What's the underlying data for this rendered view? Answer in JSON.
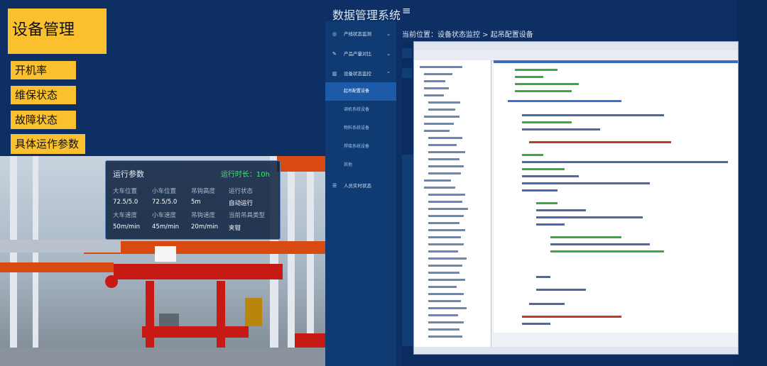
{
  "left": {
    "title": "设备管理",
    "menu": [
      "开机率",
      "维保状态",
      "故障状态",
      "具体运作参数"
    ],
    "params": {
      "title": "运行参数",
      "runtime": "运行时长：10h",
      "labels_row1": [
        "大车位置",
        "小车位置",
        "吊钩高度",
        "运行状态"
      ],
      "values_row1": [
        "72.5/5.0",
        "72.5/5.0",
        "5m",
        "自动运行"
      ],
      "labels_row2": [
        "大车速度",
        "小车速度",
        "吊钩速度",
        "当前吊具类型"
      ],
      "values_row2": [
        "50m/min",
        "45m/min",
        "20m/min",
        "夹钳"
      ]
    },
    "colors": {
      "tag_bg": "#fbc02d",
      "panel_bg": "#0d2f63",
      "runtime_green": "#4ade80"
    }
  },
  "right": {
    "system_title": "数据管理系统",
    "breadcrumb": "当前位置：设备状态监控 > 起吊配置设备",
    "sidebar": [
      {
        "icon": "target-icon",
        "label": "产线状态监测",
        "has_chevron": true
      },
      {
        "icon": "pen-icon",
        "label": "产品产量对比",
        "has_chevron": true
      },
      {
        "icon": "bar-chart-icon",
        "label": "设备状态监控",
        "has_chevron": true,
        "expanded": true
      }
    ],
    "submenu": [
      "起吊配置设备",
      "调机系统设备",
      "物料系统设备",
      "焊接系统设备",
      "其他"
    ],
    "sidebar_last": {
      "icon": "list-icon",
      "label": "人员实时状态"
    },
    "colors": {
      "sidebar_bg": "#0f3a72",
      "active": "#1d5aa8"
    }
  }
}
